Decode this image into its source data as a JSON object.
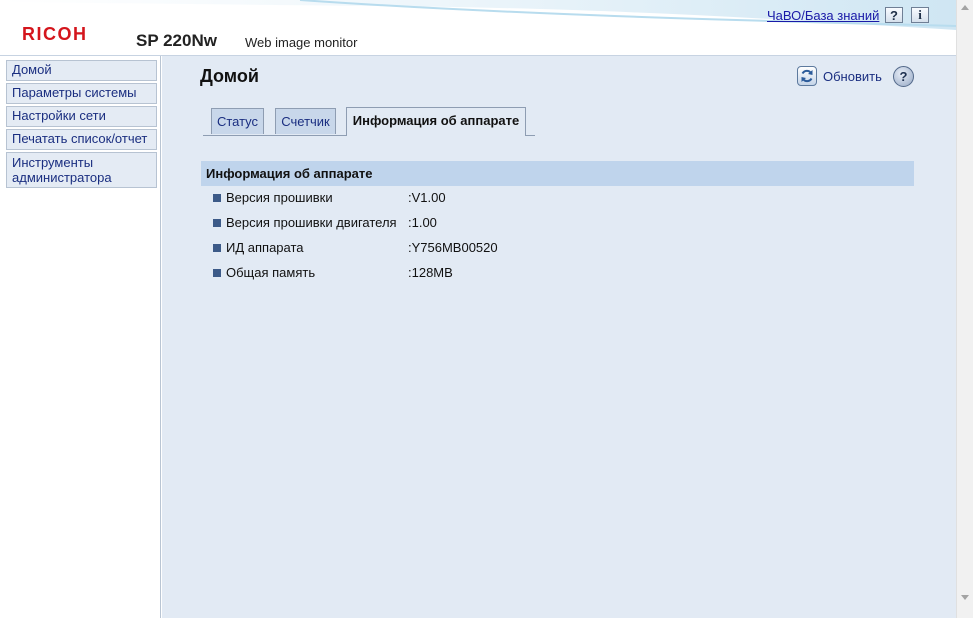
{
  "header": {
    "brand": "RICOH",
    "model": "SP 220Nw",
    "product": "Web image monitor",
    "faq_link": "ЧаВО/База знаний",
    "help_icon": "question-icon",
    "info_icon": "info-icon"
  },
  "sidebar": {
    "items": [
      {
        "label": "Домой"
      },
      {
        "label": "Параметры системы"
      },
      {
        "label": "Настройки сети"
      },
      {
        "label": "Печатать список/отчет"
      },
      {
        "label": "Инструменты администратора"
      }
    ]
  },
  "main": {
    "title": "Домой",
    "refresh_label": "Обновить",
    "tabs": [
      {
        "label": "Статус",
        "active": false
      },
      {
        "label": "Счетчик",
        "active": false
      },
      {
        "label": "Информация об аппарате",
        "active": true
      }
    ],
    "section_title": "Информация об аппарате",
    "rows": [
      {
        "label": "Версия прошивки",
        "value": ":V1.00"
      },
      {
        "label": "Версия прошивки двигателя",
        "value": ":1.00"
      },
      {
        "label": "ИД аппарата",
        "value": ":Y756MB00520"
      },
      {
        "label": "Общая память",
        "value": ":128MB"
      }
    ]
  },
  "colors": {
    "brand_red": "#d4151c",
    "link_blue": "#1a2e80",
    "section_bg": "#bfd4ec",
    "content_bg": "#e2eaf4"
  }
}
